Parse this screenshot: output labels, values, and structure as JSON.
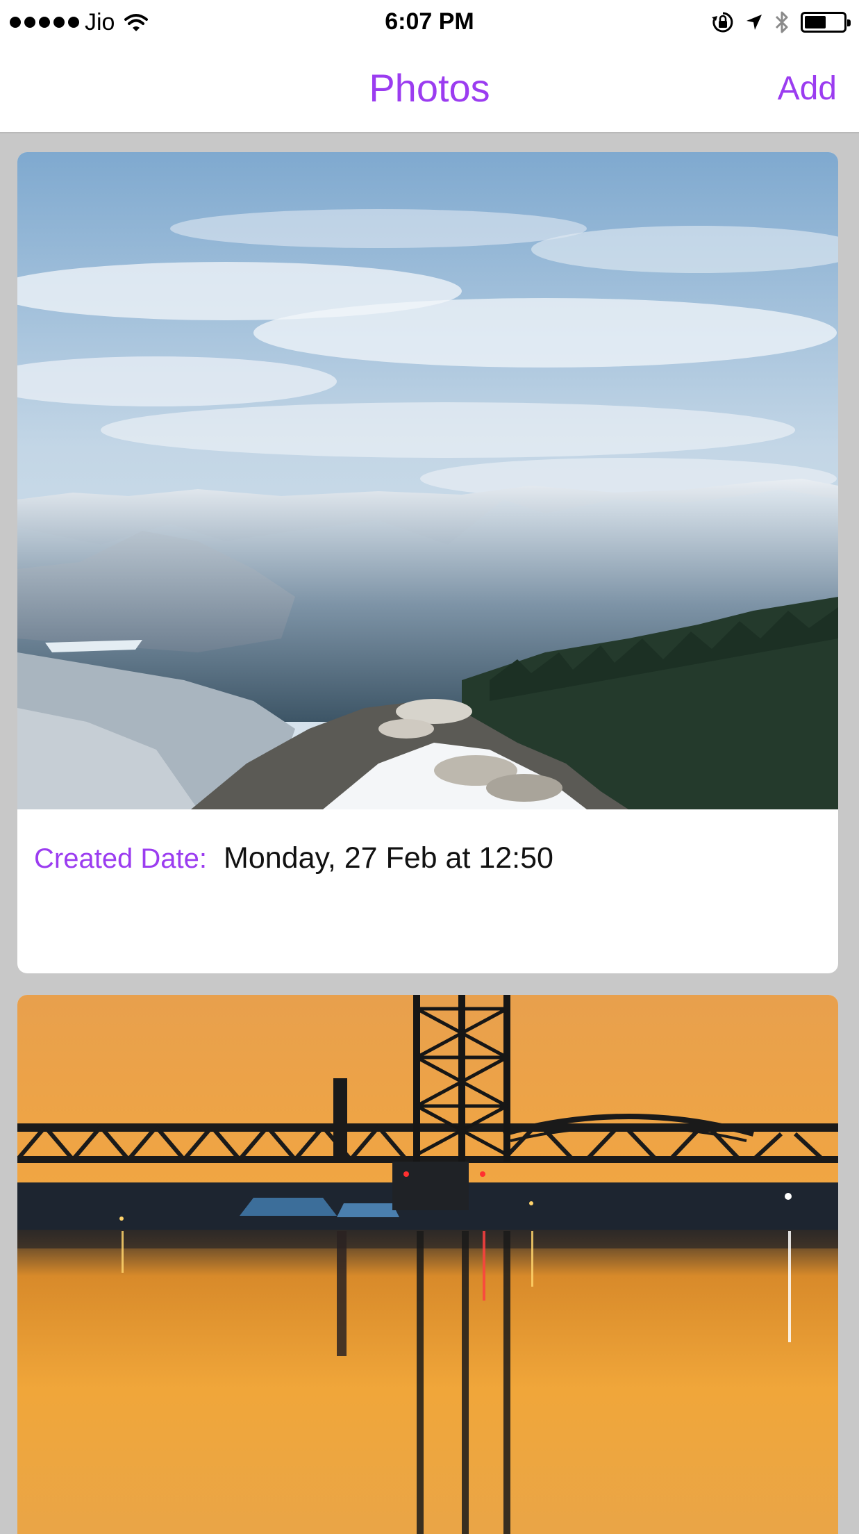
{
  "status_bar": {
    "carrier": "Jio",
    "time": "6:07 PM",
    "battery_level": 0.55,
    "icons": [
      "signal-dots-icon",
      "wifi-icon",
      "rotation-lock-icon",
      "location-arrow-icon",
      "bluetooth-icon",
      "battery-icon"
    ]
  },
  "nav": {
    "title": "Photos",
    "add_label": "Add"
  },
  "colors": {
    "accent": "#9b3cf0",
    "background": "#c8c8c8",
    "card": "#ffffff"
  },
  "photos": [
    {
      "image": "snowy-mountain-landscape",
      "created_label": "Created Date:",
      "created_value": "Monday, 27 Feb at 12:50"
    },
    {
      "image": "bridge-at-sunset"
    }
  ]
}
